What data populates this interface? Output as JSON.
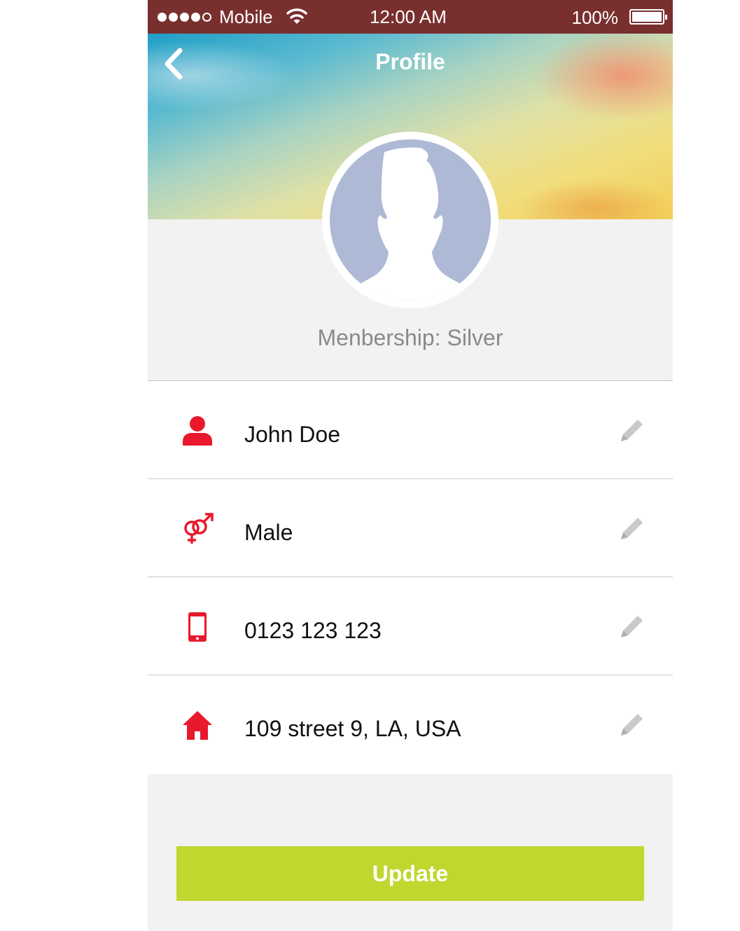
{
  "status_bar": {
    "carrier": "Mobile",
    "time": "12:00 AM",
    "battery": "100%",
    "signal_bars": 4,
    "signal_total": 5
  },
  "header": {
    "title": "Profile",
    "back_icon": "chevron-left-icon"
  },
  "profile": {
    "membership": "Menbership: Silver"
  },
  "fields": [
    {
      "icon": "person-icon",
      "value": "John Doe"
    },
    {
      "icon": "gender-icon",
      "value": "Male"
    },
    {
      "icon": "phone-icon",
      "value": "0123 123 123"
    },
    {
      "icon": "home-icon",
      "value": "109 street 9, LA, USA"
    }
  ],
  "actions": {
    "update_label": "Update"
  },
  "colors": {
    "status_bar": "#7a2f2f",
    "accent_red": "#e8192c",
    "button": "#bfd72f",
    "background": "#f2f2f2",
    "avatar": "#aeb9d6"
  }
}
